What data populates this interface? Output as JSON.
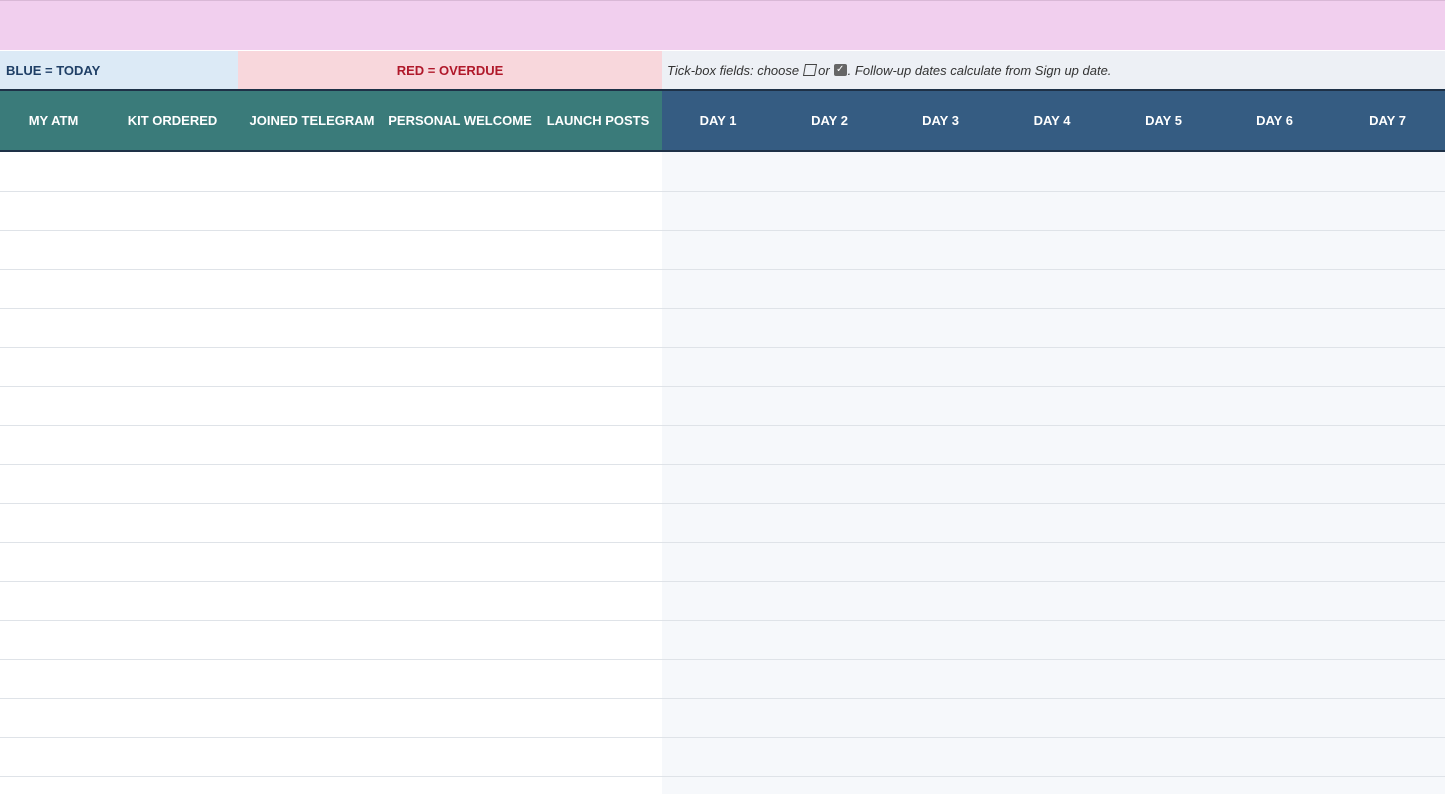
{
  "legend": {
    "blue_label": "BLUE = TODAY",
    "red_label": "RED = OVERDUE",
    "note_prefix": "Tick-box fields: choose",
    "note_or": "or",
    "note_suffix": ". Follow-up dates calculate from Sign up date."
  },
  "columns_left": [
    "MY ATM",
    "KIT ORDERED",
    "JOINED TELEGRAM",
    "PERSONAL WELCOME",
    "LAUNCH POSTS"
  ],
  "columns_right": [
    "DAY 1",
    "DAY 2",
    "DAY 3",
    "DAY 4",
    "DAY 5",
    "DAY 6",
    "DAY 7"
  ],
  "colors": {
    "banner": "#f1cfee",
    "today": "#dceaf6",
    "overdue": "#f8d7dc",
    "header_teal": "#3a7b7a",
    "header_navy": "#355c82"
  },
  "icons": {
    "unchecked": "checkbox-empty-icon",
    "checked": "checkbox-checked-icon"
  }
}
